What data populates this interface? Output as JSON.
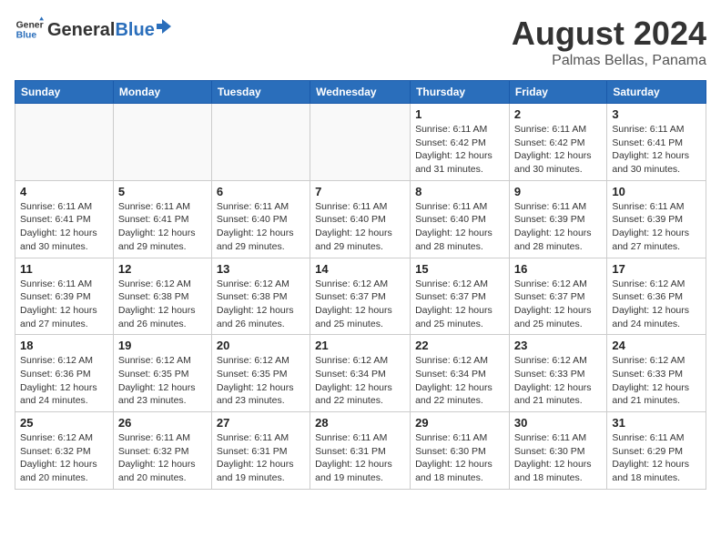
{
  "header": {
    "logo_general": "General",
    "logo_blue": "Blue",
    "month_year": "August 2024",
    "location": "Palmas Bellas, Panama"
  },
  "weekdays": [
    "Sunday",
    "Monday",
    "Tuesday",
    "Wednesday",
    "Thursday",
    "Friday",
    "Saturday"
  ],
  "weeks": [
    [
      {
        "day": "",
        "info": ""
      },
      {
        "day": "",
        "info": ""
      },
      {
        "day": "",
        "info": ""
      },
      {
        "day": "",
        "info": ""
      },
      {
        "day": "1",
        "info": "Sunrise: 6:11 AM\nSunset: 6:42 PM\nDaylight: 12 hours\nand 31 minutes."
      },
      {
        "day": "2",
        "info": "Sunrise: 6:11 AM\nSunset: 6:42 PM\nDaylight: 12 hours\nand 30 minutes."
      },
      {
        "day": "3",
        "info": "Sunrise: 6:11 AM\nSunset: 6:41 PM\nDaylight: 12 hours\nand 30 minutes."
      }
    ],
    [
      {
        "day": "4",
        "info": "Sunrise: 6:11 AM\nSunset: 6:41 PM\nDaylight: 12 hours\nand 30 minutes."
      },
      {
        "day": "5",
        "info": "Sunrise: 6:11 AM\nSunset: 6:41 PM\nDaylight: 12 hours\nand 29 minutes."
      },
      {
        "day": "6",
        "info": "Sunrise: 6:11 AM\nSunset: 6:40 PM\nDaylight: 12 hours\nand 29 minutes."
      },
      {
        "day": "7",
        "info": "Sunrise: 6:11 AM\nSunset: 6:40 PM\nDaylight: 12 hours\nand 29 minutes."
      },
      {
        "day": "8",
        "info": "Sunrise: 6:11 AM\nSunset: 6:40 PM\nDaylight: 12 hours\nand 28 minutes."
      },
      {
        "day": "9",
        "info": "Sunrise: 6:11 AM\nSunset: 6:39 PM\nDaylight: 12 hours\nand 28 minutes."
      },
      {
        "day": "10",
        "info": "Sunrise: 6:11 AM\nSunset: 6:39 PM\nDaylight: 12 hours\nand 27 minutes."
      }
    ],
    [
      {
        "day": "11",
        "info": "Sunrise: 6:11 AM\nSunset: 6:39 PM\nDaylight: 12 hours\nand 27 minutes."
      },
      {
        "day": "12",
        "info": "Sunrise: 6:12 AM\nSunset: 6:38 PM\nDaylight: 12 hours\nand 26 minutes."
      },
      {
        "day": "13",
        "info": "Sunrise: 6:12 AM\nSunset: 6:38 PM\nDaylight: 12 hours\nand 26 minutes."
      },
      {
        "day": "14",
        "info": "Sunrise: 6:12 AM\nSunset: 6:37 PM\nDaylight: 12 hours\nand 25 minutes."
      },
      {
        "day": "15",
        "info": "Sunrise: 6:12 AM\nSunset: 6:37 PM\nDaylight: 12 hours\nand 25 minutes."
      },
      {
        "day": "16",
        "info": "Sunrise: 6:12 AM\nSunset: 6:37 PM\nDaylight: 12 hours\nand 25 minutes."
      },
      {
        "day": "17",
        "info": "Sunrise: 6:12 AM\nSunset: 6:36 PM\nDaylight: 12 hours\nand 24 minutes."
      }
    ],
    [
      {
        "day": "18",
        "info": "Sunrise: 6:12 AM\nSunset: 6:36 PM\nDaylight: 12 hours\nand 24 minutes."
      },
      {
        "day": "19",
        "info": "Sunrise: 6:12 AM\nSunset: 6:35 PM\nDaylight: 12 hours\nand 23 minutes."
      },
      {
        "day": "20",
        "info": "Sunrise: 6:12 AM\nSunset: 6:35 PM\nDaylight: 12 hours\nand 23 minutes."
      },
      {
        "day": "21",
        "info": "Sunrise: 6:12 AM\nSunset: 6:34 PM\nDaylight: 12 hours\nand 22 minutes."
      },
      {
        "day": "22",
        "info": "Sunrise: 6:12 AM\nSunset: 6:34 PM\nDaylight: 12 hours\nand 22 minutes."
      },
      {
        "day": "23",
        "info": "Sunrise: 6:12 AM\nSunset: 6:33 PM\nDaylight: 12 hours\nand 21 minutes."
      },
      {
        "day": "24",
        "info": "Sunrise: 6:12 AM\nSunset: 6:33 PM\nDaylight: 12 hours\nand 21 minutes."
      }
    ],
    [
      {
        "day": "25",
        "info": "Sunrise: 6:12 AM\nSunset: 6:32 PM\nDaylight: 12 hours\nand 20 minutes."
      },
      {
        "day": "26",
        "info": "Sunrise: 6:11 AM\nSunset: 6:32 PM\nDaylight: 12 hours\nand 20 minutes."
      },
      {
        "day": "27",
        "info": "Sunrise: 6:11 AM\nSunset: 6:31 PM\nDaylight: 12 hours\nand 19 minutes."
      },
      {
        "day": "28",
        "info": "Sunrise: 6:11 AM\nSunset: 6:31 PM\nDaylight: 12 hours\nand 19 minutes."
      },
      {
        "day": "29",
        "info": "Sunrise: 6:11 AM\nSunset: 6:30 PM\nDaylight: 12 hours\nand 18 minutes."
      },
      {
        "day": "30",
        "info": "Sunrise: 6:11 AM\nSunset: 6:30 PM\nDaylight: 12 hours\nand 18 minutes."
      },
      {
        "day": "31",
        "info": "Sunrise: 6:11 AM\nSunset: 6:29 PM\nDaylight: 12 hours\nand 18 minutes."
      }
    ]
  ]
}
